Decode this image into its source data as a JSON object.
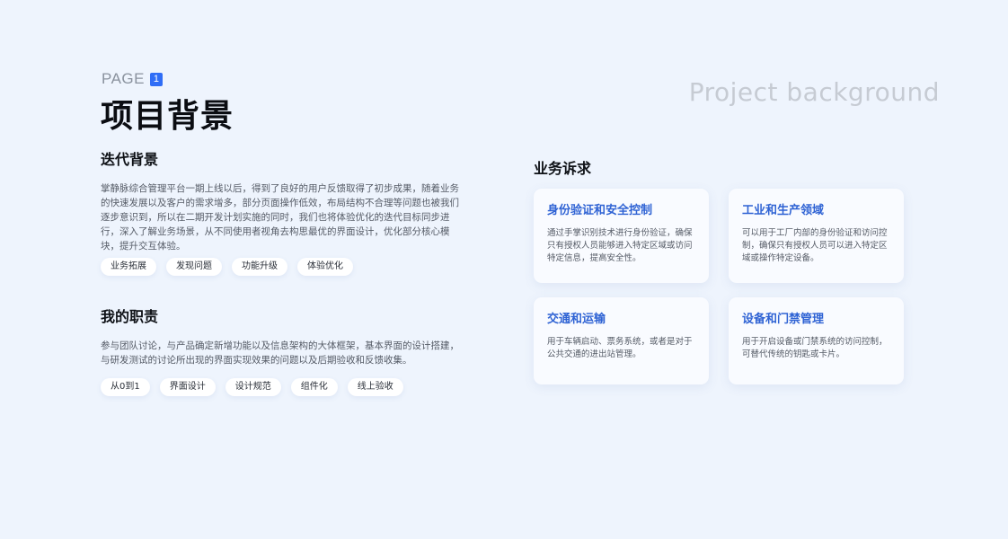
{
  "header": {
    "page_label": "PAGE",
    "page_number": "1",
    "title": "项目背景",
    "title_en": "Project background"
  },
  "iteration_background": {
    "heading": "迭代背景",
    "body": "掌静脉综合管理平台一期上线以后，得到了良好的用户反馈取得了初步成果，随着业务的快速发展以及客户的需求增多，部分页面操作低效，布局结构不合理等问题也被我们逐步意识到，所以在二期开发计划实施的同时，我们也将体验优化的迭代目标同步进行，深入了解业务场景，从不同使用者视角去构思最优的界面设计，优化部分核心模块，提升交互体验。",
    "tags": [
      "业务拓展",
      "发现问题",
      "功能升级",
      "体验优化"
    ]
  },
  "my_role": {
    "heading": "我的职责",
    "body": "参与团队讨论，与产品确定新增功能以及信息架构的大体框架，基本界面的设计搭建，与研发测试的讨论所出现的界面实现效果的问题以及后期验收和反馈收集。",
    "tags": [
      "从0到1",
      "界面设计",
      "设计规范",
      "组件化",
      "线上验收"
    ]
  },
  "business_demands": {
    "heading": "业务诉求",
    "cards": [
      {
        "title": "身份验证和安全控制",
        "desc": "通过手掌识别技术进行身份验证，确保只有授权人员能够进入特定区域或访问特定信息，提高安全性。"
      },
      {
        "title": "工业和生产领域",
        "desc": "可以用于工厂内部的身份验证和访问控制，确保只有授权人员可以进入特定区域或操作特定设备。"
      },
      {
        "title": "交通和运输",
        "desc": "用于车辆启动、票务系统，或者是对于公共交通的进出站管理。"
      },
      {
        "title": "设备和门禁管理",
        "desc": "用于开启设备或门禁系统的访问控制，可替代传统的钥匙或卡片。"
      }
    ]
  }
}
